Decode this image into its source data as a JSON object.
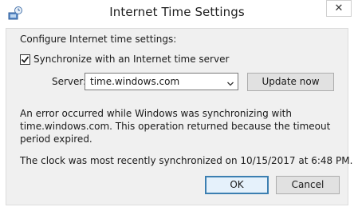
{
  "window": {
    "title": "Internet Time Settings",
    "close_glyph": "✕"
  },
  "dialog": {
    "heading": "Configure Internet time settings:",
    "sync_checkbox": {
      "label": "Synchronize with an Internet time server",
      "checked": true
    },
    "server": {
      "label": "Server:",
      "value": "time.windows.com"
    },
    "update_button": "Update now",
    "error_message": "An error occurred while Windows was synchronizing with time.windows.com.  This operation returned because the timeout period expired.",
    "last_sync": "The clock was most recently synchronized on 10/15/2017 at 6:48 PM.",
    "ok_button": "OK",
    "cancel_button": "Cancel"
  },
  "icons": {
    "title_icon": "internet-clock-icon",
    "close_icon": "close-icon",
    "dropdown_icon": "chevron-down-icon",
    "check_icon": "checkmark-icon"
  },
  "colors": {
    "client_bg": "#f0f0f0",
    "default_button_border": "#3c7fb1"
  }
}
